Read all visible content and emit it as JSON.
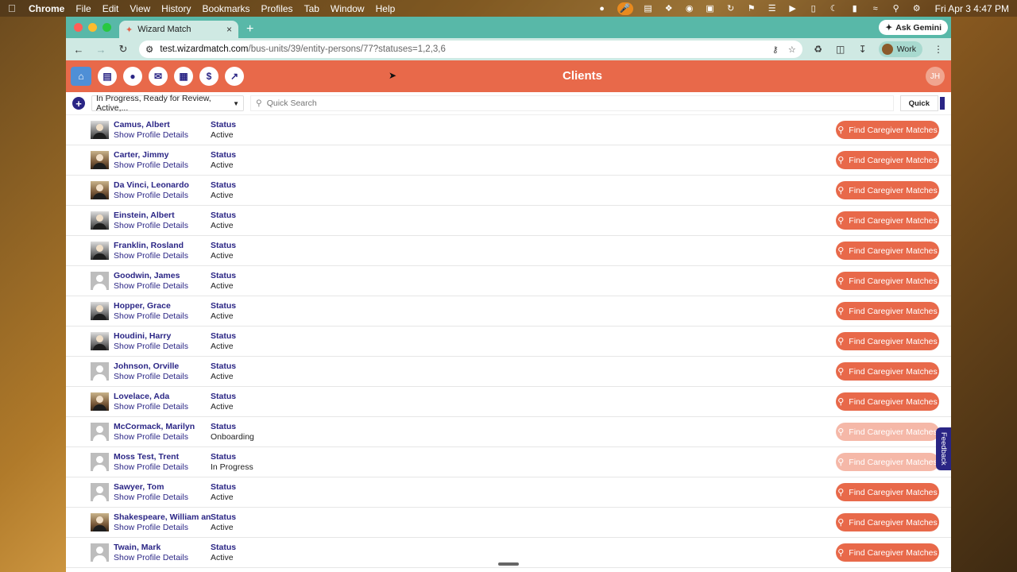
{
  "menubar": {
    "app_name": "Chrome",
    "menus": [
      "File",
      "Edit",
      "View",
      "History",
      "Bookmarks",
      "Profiles",
      "Tab",
      "Window",
      "Help"
    ],
    "clock": "Fri Apr 3  4:47 PM"
  },
  "browser": {
    "tab_title": "Wizard Match",
    "gemini_label": "Ask Gemini",
    "url_host": "test.wizardmatch.com",
    "url_path": "/bus-units/39/entity-persons/77?statuses=1,2,3,6",
    "profile_label": "Work"
  },
  "app": {
    "title": "Clients",
    "user_initials": "JH",
    "header_icons": [
      "home-icon",
      "bed-icon",
      "person-icon",
      "chat-icon",
      "calendar-icon",
      "dollar-icon",
      "chart-icon"
    ],
    "colors": {
      "accent": "#e8694a",
      "primary": "#2a2585",
      "disabled": "#f5b8a8"
    }
  },
  "filters": {
    "status_selected": "In Progress, Ready for Review, Active,...",
    "search_placeholder": "Quick Search",
    "quick_label": "Quick"
  },
  "list": {
    "profile_link_label": "Show Profile Details",
    "status_label": "Status",
    "match_button_label": "Find Caregiver Matches",
    "clients": [
      {
        "name": "Camus, Albert",
        "status": "Active",
        "photo": "has-photo",
        "enabled": true
      },
      {
        "name": "Carter, Jimmy",
        "status": "Active",
        "photo": "color-photo",
        "enabled": true
      },
      {
        "name": "Da Vinci, Leonardo",
        "status": "Active",
        "photo": "color-photo",
        "enabled": true
      },
      {
        "name": "Einstein, Albert",
        "status": "Active",
        "photo": "has-photo",
        "enabled": true
      },
      {
        "name": "Franklin, Rosland",
        "status": "Active",
        "photo": "has-photo",
        "enabled": true
      },
      {
        "name": "Goodwin, James",
        "status": "Active",
        "photo": "placeholder",
        "enabled": true
      },
      {
        "name": "Hopper, Grace",
        "status": "Active",
        "photo": "has-photo",
        "enabled": true
      },
      {
        "name": "Houdini, Harry",
        "status": "Active",
        "photo": "has-photo",
        "enabled": true
      },
      {
        "name": "Johnson, Orville",
        "status": "Active",
        "photo": "placeholder",
        "enabled": true
      },
      {
        "name": "Lovelace, Ada",
        "status": "Active",
        "photo": "color-photo",
        "enabled": true
      },
      {
        "name": "McCormack, Marilyn",
        "status": "Onboarding",
        "photo": "placeholder",
        "enabled": false
      },
      {
        "name": "Moss Test, Trent",
        "status": "In Progress",
        "photo": "placeholder",
        "enabled": false
      },
      {
        "name": "Sawyer, Tom",
        "status": "Active",
        "photo": "placeholder",
        "enabled": true
      },
      {
        "name": "Shakespeare, William and I",
        "status": "Active",
        "photo": "color-photo",
        "enabled": true
      },
      {
        "name": "Twain, Mark",
        "status": "Active",
        "photo": "placeholder",
        "enabled": true
      }
    ]
  },
  "feedback_label": "Feedback"
}
